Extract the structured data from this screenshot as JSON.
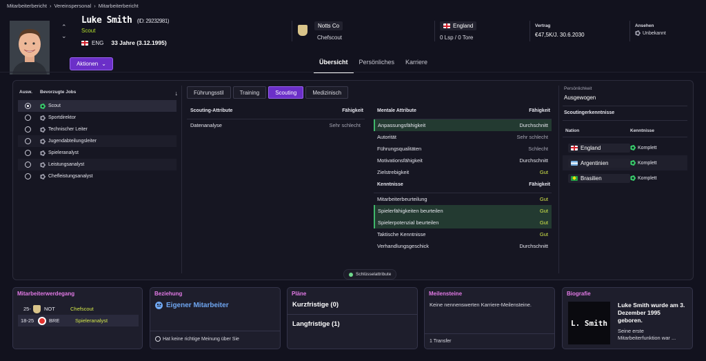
{
  "breadcrumb": [
    "Mitarbeiterbericht",
    "Vereinspersonal",
    "Mitarbeiterbericht"
  ],
  "person": {
    "name": "Luke Smith",
    "id": "(ID: 29232981)",
    "role": "Scout",
    "nationality_code": "ENG",
    "age": "33 Jahre (3.12.1995)"
  },
  "club": {
    "name": "Notts Co",
    "role": "Chefscout"
  },
  "nation": {
    "name": "England",
    "caps": "0 Lsp / 0 Tore"
  },
  "contract": {
    "label": "Vertrag",
    "value": "€47,5K/J. 30.6.2030"
  },
  "reputation": {
    "label": "Ansehen",
    "value": "Unbekannt"
  },
  "actions_label": "Aktionen",
  "main_tabs": [
    "Übersicht",
    "Persönliches",
    "Karriere"
  ],
  "jobs": {
    "head_select": "Ausw.",
    "head_jobs": "Bevorzugte Jobs",
    "items": [
      "Scout",
      "Sportdirektor",
      "Technischer Leiter",
      "Jugendabteilungsleiter",
      "Spieleranalyst",
      "Leistungsanalyst",
      "Chefleistungsanalyst"
    ]
  },
  "sub_tabs": [
    "Führungsstil",
    "Training",
    "Scouting",
    "Medizinisch"
  ],
  "scouting": {
    "head": "Scouting-Attribute",
    "head_value": "Fähigkeit",
    "rows": [
      {
        "name": "Datenanalyse",
        "value": "Sehr schlecht"
      }
    ]
  },
  "mental": {
    "head": "Mentale Attribute",
    "head_value": "Fähigkeit",
    "rows": [
      {
        "name": "Anpassungsfähigkeit",
        "value": "Durchschnitt"
      },
      {
        "name": "Autorität",
        "value": "Sehr schlecht"
      },
      {
        "name": "Führungsqualitäten",
        "value": "Schlecht"
      },
      {
        "name": "Motivationsfähigkeit",
        "value": "Durchschnitt"
      },
      {
        "name": "Zielstrebigkeit",
        "value": "Gut"
      }
    ]
  },
  "knowledge": {
    "head": "Kenntnisse",
    "head_value": "Fähigkeit",
    "rows": [
      {
        "name": "Mitarbeiterbeurteilung",
        "value": "Gut"
      },
      {
        "name": "Spielerfähigkeiten beurteilen",
        "value": "Gut"
      },
      {
        "name": "Spielerpotenzial beurteilen",
        "value": "Gut"
      },
      {
        "name": "Taktische Kenntnisse",
        "value": "Gut"
      },
      {
        "name": "Verhandlungsgeschick",
        "value": "Durchschnitt"
      }
    ]
  },
  "personality": {
    "label": "Persönlichkeit",
    "value": "Ausgewogen"
  },
  "scouting_knowledge": {
    "title": "Scoutingerkenntnisse",
    "head_nation": "Nation",
    "head_knowledge": "Kenntnisse",
    "rows": [
      {
        "nation": "England",
        "value": "Komplett"
      },
      {
        "nation": "Argentinien",
        "value": "Komplett"
      },
      {
        "nation": "Brasilien",
        "value": "Komplett"
      }
    ]
  },
  "key_attributes_label": "Schlüsselattribute",
  "career": {
    "title": "Mitarbeiterwerdegang",
    "rows": [
      {
        "years": "25-",
        "club": "NOT",
        "role": "Chefscout"
      },
      {
        "years": "18-25",
        "club": "BRE",
        "role": "Spieleranalyst"
      }
    ]
  },
  "relationship": {
    "title": "Beziehung",
    "value": "Eigener Mitarbeiter",
    "footer": "Hat keine richtige Meinung über Sie"
  },
  "plans": {
    "title": "Pläne",
    "short": "Kurzfristige  (0)",
    "long": "Langfristige  (1)"
  },
  "milestones": {
    "title": "Meilensteine",
    "text": "Keine nennenswerten Karriere-Meilensteine.",
    "footer": "1 Transfer"
  },
  "biography": {
    "title": "Biografie",
    "initials": "L. Smith",
    "headline": "Luke Smith wurde am 3. Dezember 1995 geboren.",
    "text": "Seine erste Mitarbeiterfunktion war ..."
  },
  "colors": {
    "accent": "#6b2fc8",
    "positive": "#b5e22d",
    "section_title": "#e27ae6",
    "relationship": "#6fa7f2"
  }
}
